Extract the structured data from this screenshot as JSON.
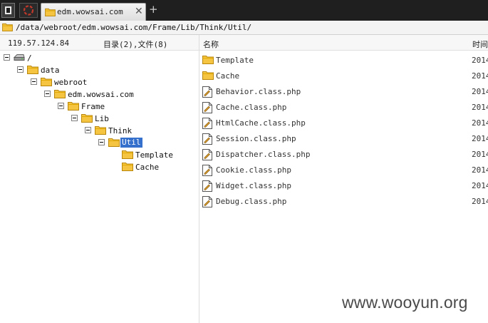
{
  "tab": {
    "title": "edm.wowsai.com",
    "close_glyph": "✕",
    "new_tab_glyph": "+"
  },
  "address": {
    "path": "/data/webroot/edm.wowsai.com/Frame/Lib/Think/Util/"
  },
  "header": {
    "host": "119.57.124.84",
    "dir_summary": "目录(2),文件(8)",
    "col_name": "名称",
    "col_time": "时间"
  },
  "tree": [
    {
      "label": "/",
      "icon": "drive-icon",
      "depth": 0
    },
    {
      "label": "data",
      "icon": "folder-icon",
      "depth": 1
    },
    {
      "label": "webroot",
      "icon": "folder-icon",
      "depth": 2
    },
    {
      "label": "edm.wowsai.com",
      "icon": "folder-icon",
      "depth": 3
    },
    {
      "label": "Frame",
      "icon": "folder-icon",
      "depth": 4
    },
    {
      "label": "Lib",
      "icon": "folder-icon",
      "depth": 5
    },
    {
      "label": "Think",
      "icon": "folder-icon",
      "depth": 6
    },
    {
      "label": "Util",
      "icon": "folder-icon",
      "depth": 7,
      "selected": true
    },
    {
      "label": "Template",
      "icon": "folder-icon",
      "depth": 8,
      "leaf": true
    },
    {
      "label": "Cache",
      "icon": "folder-icon",
      "depth": 8,
      "leaf": true
    }
  ],
  "files": [
    {
      "name": "Template",
      "type": "folder",
      "time": "2014"
    },
    {
      "name": "Cache",
      "type": "folder",
      "time": "2014"
    },
    {
      "name": "Behavior.class.php",
      "type": "file",
      "time": "2014"
    },
    {
      "name": "Cache.class.php",
      "type": "file",
      "time": "2014"
    },
    {
      "name": "HtmlCache.class.php",
      "type": "file",
      "time": "2014"
    },
    {
      "name": "Session.class.php",
      "type": "file",
      "time": "2014"
    },
    {
      "name": "Dispatcher.class.php",
      "type": "file",
      "time": "2014"
    },
    {
      "name": "Cookie.class.php",
      "type": "file",
      "time": "2014"
    },
    {
      "name": "Widget.class.php",
      "type": "file",
      "time": "2014"
    },
    {
      "name": "Debug.class.php",
      "type": "file",
      "time": "2014"
    }
  ],
  "watermark": "www.wooyun.org",
  "colors": {
    "tabbar": "#1f1f1f",
    "folder": "#f5c542",
    "selection": "#3470cc",
    "record": "#c0392b"
  }
}
